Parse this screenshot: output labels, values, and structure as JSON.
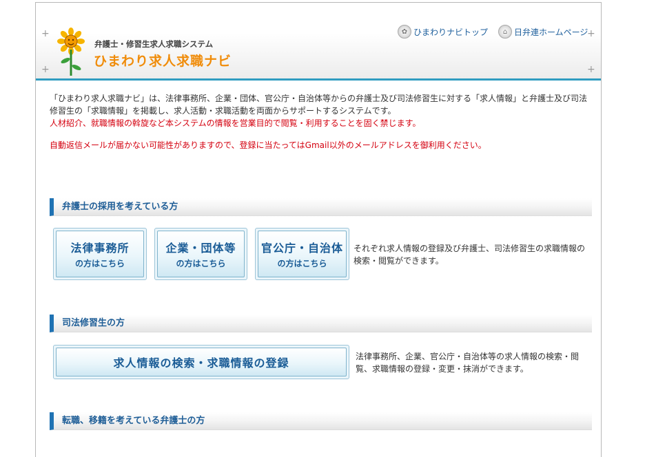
{
  "header": {
    "logo_sub": "弁護士・修習生求人求職システム",
    "logo_main": "ひまわり求人求職ナビ",
    "links": [
      {
        "label": "ひまわりナビトップ",
        "icon": "sunflower-icon"
      },
      {
        "label": "日弁連ホームページ",
        "icon": "home-icon"
      }
    ]
  },
  "intro": {
    "line1": "「ひまわり求人求職ナビ」は、法律事務所、企業・団体、官公庁・自治体等からの弁護士及び司法修習生に対する「求人情報」と弁護士及び司法",
    "line2": "修習生の「求職情報」を掲載し、求人活動・求職活動を両面からサポートするシステムです。",
    "warn1": "人材紹介、就職情報の斡旋など本システムの情報を営業目的で閲覧・利用することを固く禁じます。",
    "warn2": "自動返信メールが届かない可能性がありますので、登録に当たってはGmail以外のメールアドレスを御利用ください。"
  },
  "section1": {
    "title": "弁護士の採用を考えている方",
    "buttons": [
      {
        "l1": "法律事務所",
        "l2": "の方はこちら"
      },
      {
        "l1": "企業・団体等",
        "l2": "の方はこちら"
      },
      {
        "l1": "官公庁・自治体",
        "l2": "の方はこちら"
      }
    ],
    "desc1": "それぞれ求人情報の登録及び弁護士、司法修習生の求職情報の",
    "desc2": "検索・閲覧ができます。"
  },
  "section2": {
    "title": "司法修習生の方",
    "button": "求人情報の検索・求職情報の登録",
    "desc1": "法律事務所、企業、官公庁・自治体等の求人情報の検索・閲",
    "desc2": "覧、求職情報の登録・変更・抹消ができます。"
  },
  "section3": {
    "title": "転職、移籍を考えている弁護士の方"
  },
  "colors": {
    "accent": "#1f72b3",
    "header_rule": "#2f9cc0",
    "logo": "#f08c0a",
    "warning": "#d4000f"
  }
}
